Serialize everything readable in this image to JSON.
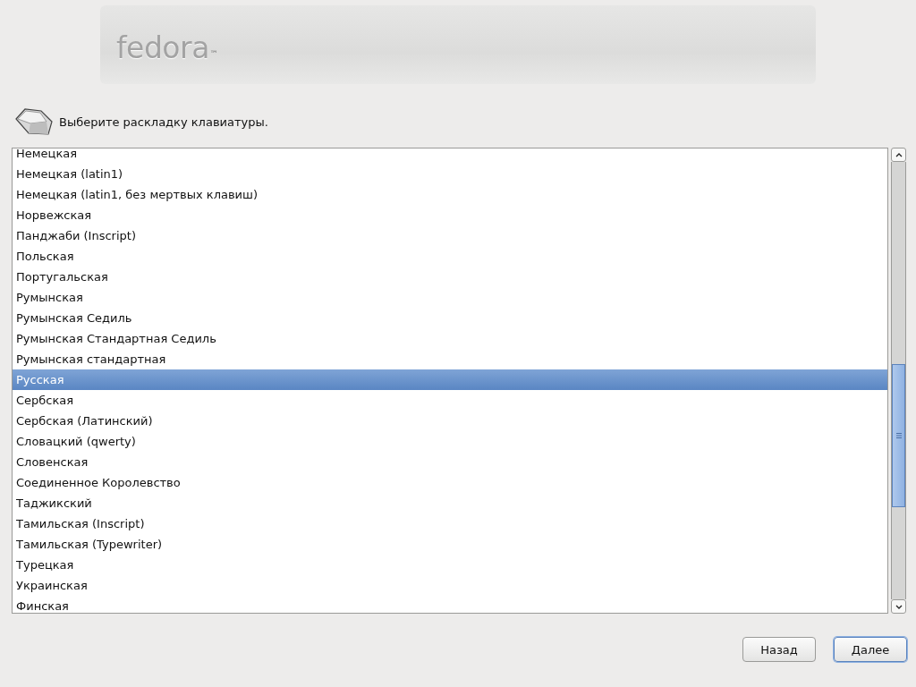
{
  "logo": {
    "wordmark": "fedora",
    "trademark": "™"
  },
  "prompt": "Выберите раскладку клавиатуры.",
  "layouts": [
    {
      "label": "Немецкая",
      "selected": false
    },
    {
      "label": "Немецкая (latin1)",
      "selected": false
    },
    {
      "label": "Немецкая (latin1, без мертвых клавиш)",
      "selected": false
    },
    {
      "label": "Норвежская",
      "selected": false
    },
    {
      "label": "Панджаби (Inscript)",
      "selected": false
    },
    {
      "label": "Польская",
      "selected": false
    },
    {
      "label": "Португальская",
      "selected": false
    },
    {
      "label": "Румынская",
      "selected": false
    },
    {
      "label": "Румынская Седиль",
      "selected": false
    },
    {
      "label": "Румынская Стандартная Седиль",
      "selected": false
    },
    {
      "label": "Румынская стандартная",
      "selected": false
    },
    {
      "label": "Русская",
      "selected": true
    },
    {
      "label": "Сербская",
      "selected": false
    },
    {
      "label": "Сербская (Латинский)",
      "selected": false
    },
    {
      "label": "Словацкий (qwerty)",
      "selected": false
    },
    {
      "label": "Словенская",
      "selected": false
    },
    {
      "label": "Соединенное Королевство",
      "selected": false
    },
    {
      "label": "Таджикский",
      "selected": false
    },
    {
      "label": "Тамильская (Inscript)",
      "selected": false
    },
    {
      "label": "Тамильская (Typewriter)",
      "selected": false
    },
    {
      "label": "Турецкая",
      "selected": false
    },
    {
      "label": "Украинская",
      "selected": false
    },
    {
      "label": "Финская",
      "selected": false
    }
  ],
  "buttons": [
    {
      "label": "Назад",
      "focused": false
    },
    {
      "label": "Далее",
      "focused": true
    }
  ]
}
